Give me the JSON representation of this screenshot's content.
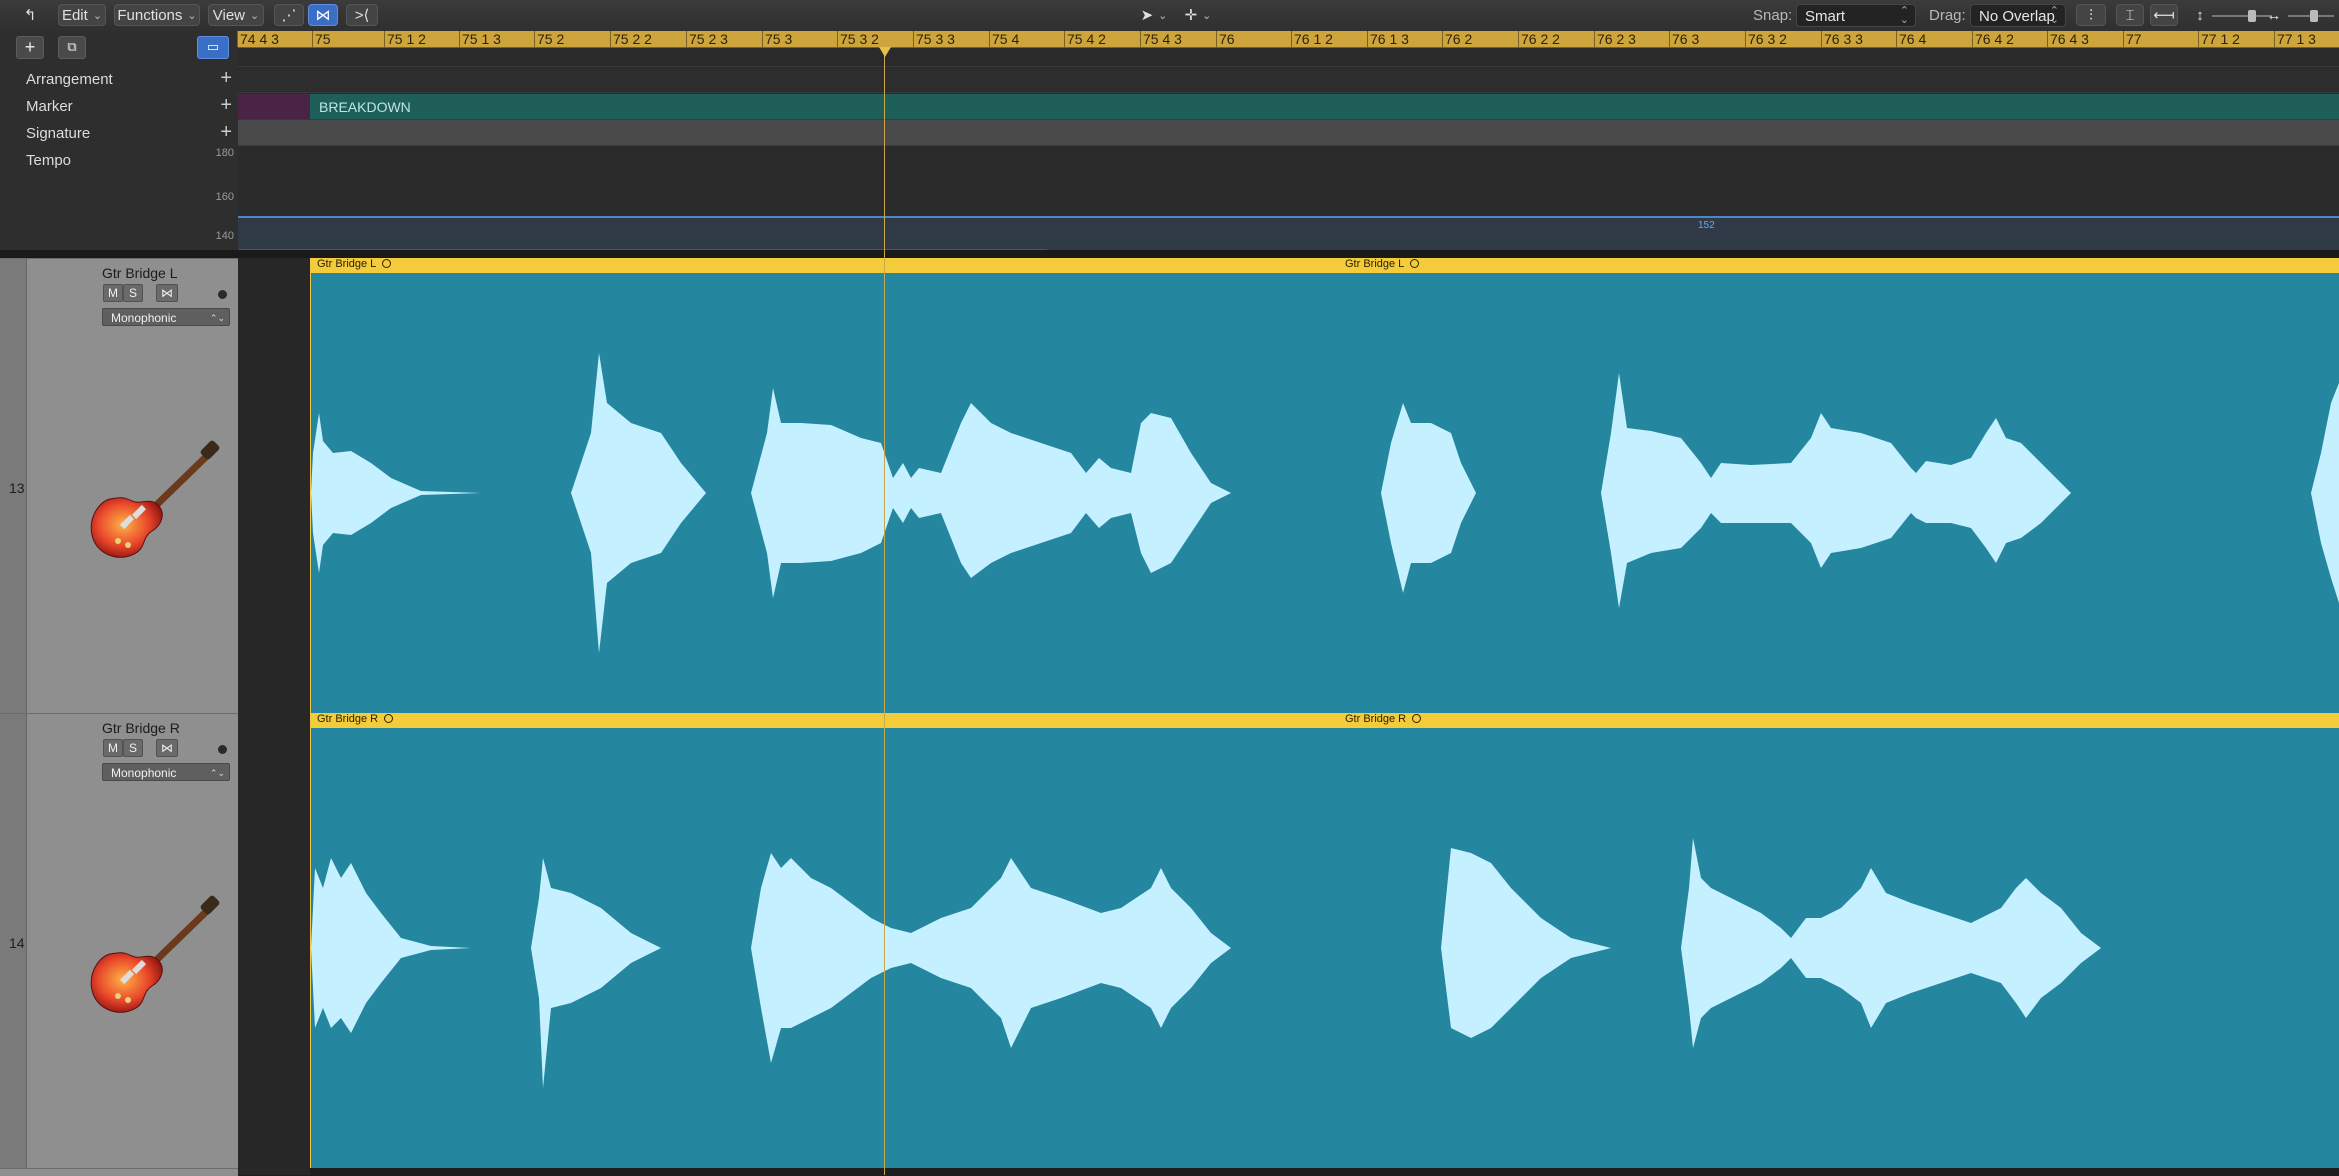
{
  "toolbar": {
    "edit": "Edit",
    "functions": "Functions",
    "view": "View",
    "snap_label": "Snap:",
    "snap_value": "Smart",
    "drag_label": "Drag:",
    "drag_value": "No Overlap"
  },
  "ruler": {
    "ticks": [
      "74 4 3",
      "75",
      "75 1 2",
      "75 1 3",
      "75 2",
      "75 2 2",
      "75 2 3",
      "75 3",
      "75 3 2",
      "75 3 3",
      "75 4",
      "75 4 2",
      "75 4 3",
      "76",
      "76 1 2",
      "76 1 3",
      "76 2",
      "76 2 2",
      "76 2 3",
      "76 3",
      "76 3 2",
      "76 3 3",
      "76 4",
      "76 4 2",
      "76 4 3",
      "77",
      "77 1 2",
      "77 1 3"
    ]
  },
  "global_tracks": {
    "arrangement": "Arrangement",
    "marker": "Marker",
    "signature": "Signature",
    "tempo": "Tempo",
    "tempo_ticks": [
      "180",
      "160",
      "140"
    ],
    "marker_name": "BREAKDOWN",
    "tempo_value": "152"
  },
  "tracks": [
    {
      "number": "13",
      "name": "Gtr  Bridge L",
      "mute": "M",
      "solo": "S",
      "mode": "Monophonic",
      "region_label": "Gtr  Bridge L"
    },
    {
      "number": "14",
      "name": "Gtr Bridge R",
      "mute": "M",
      "solo": "S",
      "mode": "Monophonic",
      "region_label": "Gtr Bridge R"
    }
  ],
  "colors": {
    "region": "#24879f",
    "region_header": "#f4cb3a",
    "waveform": "#c4f0ff",
    "marker": "#1f5f5a",
    "ruler": "#cda53c",
    "playhead": "#c9a84a"
  }
}
